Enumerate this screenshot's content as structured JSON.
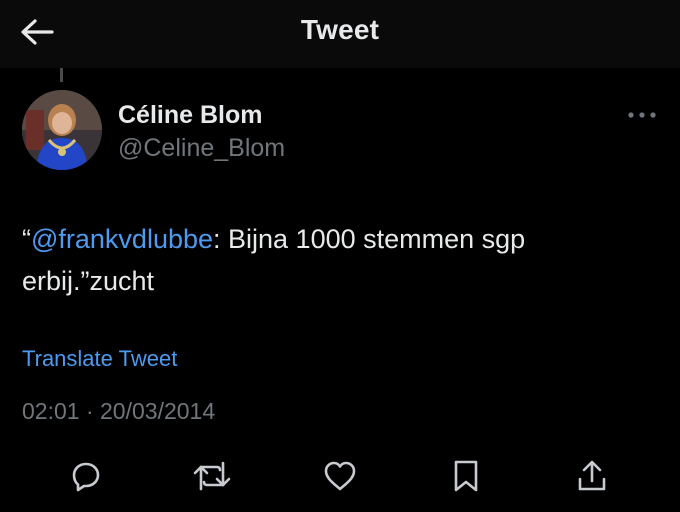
{
  "header": {
    "title": "Tweet",
    "back_icon": "arrow-left-icon"
  },
  "tweet": {
    "author_name": "Céline Blom",
    "author_handle": "@Celine_Blom",
    "text_open_quote": "“",
    "mention": "@frankvdlubbe",
    "text_body": ": Bijna 1000 stemmen sgp erbij.”zucht",
    "translate_label": "Translate Tweet",
    "time": "02:01",
    "separator": " · ",
    "date": "20/03/2014"
  },
  "actions": [
    {
      "name": "reply",
      "icon": "reply-icon"
    },
    {
      "name": "retweet",
      "icon": "retweet-icon"
    },
    {
      "name": "like",
      "icon": "heart-icon"
    },
    {
      "name": "bookmark",
      "icon": "bookmark-icon"
    },
    {
      "name": "share",
      "icon": "share-icon"
    }
  ],
  "colors": {
    "background": "#000000",
    "text": "#e7e9ea",
    "secondary_text": "#71767b",
    "link": "#4d9bf0"
  }
}
